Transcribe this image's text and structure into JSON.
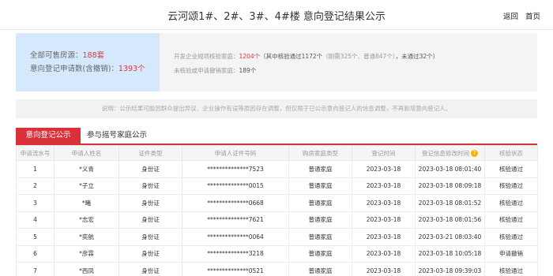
{
  "header": {
    "title": "云河颂1#、2#、3#、4#楼 意向登记结果公示",
    "back_label": "返回",
    "home_label": "首页"
  },
  "summary": {
    "available_label": "全部可售房源：",
    "available_value": "188套",
    "applications_label": "意向登记申请数(含撤销)：",
    "applications_value": "1393个",
    "verified_prefix": "开发企业规项核验家庭：",
    "verified_value": "1204个",
    "verified_detail_open": "（其中核验通过1172个",
    "verified_detail_sub": "（刚需325个、普通847个）",
    "verified_detail_fail": "，未通过32个）",
    "unverified_label": "未核验或申请撤销家庭：",
    "unverified_value": "189个"
  },
  "notice": "说明：公示结果可能因群众提出异议、企业操作有误等原因存在调整，但仅限于已公示意向登记人的信息调整，不再新增意向登记人。",
  "tabs": [
    {
      "label": "意向登记公示"
    },
    {
      "label": "参与摇号家庭公示"
    }
  ],
  "table": {
    "headers": [
      "申请流水号",
      "申请人姓名",
      "证件类型",
      "申请人证件号码",
      "购房家庭类型",
      "登记时间",
      "登记信息修改时间",
      "核验状态"
    ],
    "rows": [
      [
        "1",
        "*义青",
        "身份证",
        "**************7523",
        "普通家庭",
        "2023-03-18",
        "2023-03-18 08:01:40",
        "核验通过"
      ],
      [
        "2",
        "*子立",
        "身份证",
        "**************0015",
        "普通家庭",
        "2023-03-18",
        "2023-03-18 08:09:18",
        "核验通过"
      ],
      [
        "3",
        "*曦",
        "身份证",
        "**************0668",
        "普通家庭",
        "2023-03-18",
        "2023-03-18 08:01:52",
        "核验通过"
      ],
      [
        "4",
        "*志宏",
        "身份证",
        "**************7621",
        "普通家庭",
        "2023-03-18",
        "2023-03-18 08:01:56",
        "核验通过"
      ],
      [
        "5",
        "*奕航",
        "身份证",
        "**************0064",
        "普通家庭",
        "2023-03-18",
        "2023-03-21 08:03:40",
        "核验通过"
      ],
      [
        "6",
        "*彦霖",
        "身份证",
        "**************3218",
        "普通家庭",
        "2023-03-18",
        "2023-03-18 10:05:18",
        "申请撤销"
      ],
      [
        "7",
        "*西凤",
        "身份证",
        "**************0521",
        "普通家庭",
        "2023-03-18",
        "2023-03-18 09:39:03",
        "核验通过"
      ]
    ]
  }
}
